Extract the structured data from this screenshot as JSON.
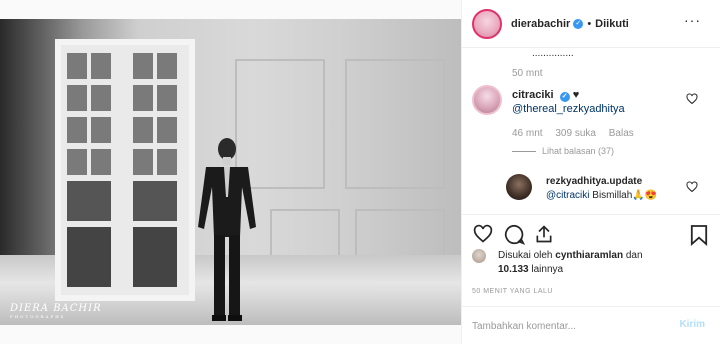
{
  "photo": {
    "watermark": "DIERA BACHIR",
    "watermark_sub": "PHOTOGRAPHS"
  },
  "header": {
    "username": "dierabachir",
    "verified": "✓",
    "separator": "•",
    "follow_status": "Diikuti",
    "more": "···"
  },
  "comments": {
    "truncated_line": "...............",
    "prev_time": "50 mnt",
    "c1": {
      "username": "citraciki",
      "verified": "✓",
      "suffix": "♥",
      "text": "@thereal_rezkyadhitya",
      "time": "46 mnt",
      "likes": "309 suka",
      "reply": "Balas",
      "view_replies": "Lihat balasan (37)"
    },
    "c2": {
      "username": "rezkyadhitya.update",
      "mention": "@citraciki",
      "text": " Bismillah🙏😍"
    }
  },
  "likes": {
    "prefix": "Disukai oleh ",
    "user": "cynthiaramlan",
    "and": " dan",
    "count": "10.133",
    "rest": " lainnya"
  },
  "timestamp": "50 MENIT YANG LALU",
  "composer": {
    "placeholder": "Tambahkan komentar...",
    "send": "Kirim"
  },
  "colors": {
    "link": "#003569",
    "verified": "#3897f0",
    "muted": "#999999"
  }
}
